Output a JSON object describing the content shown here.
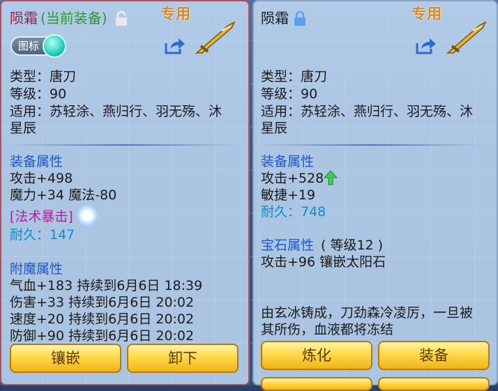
{
  "left": {
    "name": "陨霜",
    "current": "(当前装备)",
    "exclusive": "专用",
    "icon_toggle": "图标",
    "type": "类型：唐刀",
    "level": "等级：90",
    "applicable_1": "适用：苏轻涂、燕归行、羽无殇、沐",
    "applicable_2": "星辰",
    "attr_title": "装备属性",
    "attack": "攻击+498",
    "magic": "魔力+34 魔法-80",
    "special": "[法术暴击]",
    "durability": "耐久：147",
    "enchant_title": "附魔属性",
    "enchant": [
      "气血+183 持续到6月6日 18:39",
      "伤害+33 持续到6月6日 20:02",
      "速度+20 持续到6月6日 20:02",
      "防御+90 持续到6月6日 20:02"
    ],
    "btn_inlay": "镶嵌",
    "btn_unequip": "卸下"
  },
  "right": {
    "name": "陨霜",
    "exclusive": "专用",
    "type": "类型：唐刀",
    "level": "等级：90",
    "applicable_1": "适用：苏轻涂、燕归行、羽无殇、沐",
    "applicable_2": "星辰",
    "attr_title": "装备属性",
    "attack": "攻击+528",
    "agility": "敏捷+19",
    "durability": "耐久：748",
    "gem_title": "宝石属性",
    "gem_level": "( 等级12 )",
    "gem_value": "攻击+96 镶嵌太阳石",
    "desc_1": "由玄冰铸成，刀劲森冷凌厉，一旦被",
    "desc_2": "其所伤，血液都将冻结",
    "btn_refine": "炼化",
    "btn_equip": "装备"
  },
  "colors": {
    "section": "#1f57c7",
    "durability": "#0c8fcf",
    "button": "#ffd94a",
    "current": "#2b9a2e"
  },
  "icons": [
    "unlock-icon",
    "lock-icon",
    "share-icon",
    "weapon-icon",
    "refresh-icon",
    "up-arrow-icon"
  ]
}
